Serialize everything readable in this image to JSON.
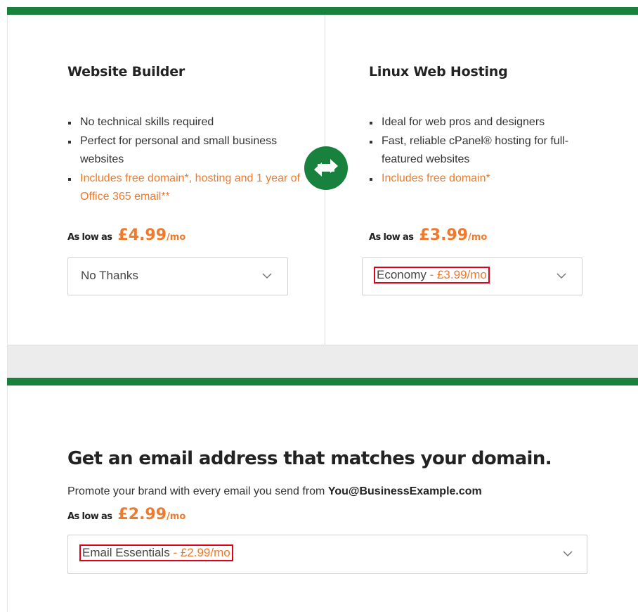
{
  "website_builder": {
    "title": "Website Builder",
    "features": [
      "No technical skills required",
      "Perfect for personal and small business websites",
      "Includes free domain*, hosting and 1 year of Office 365 email**"
    ],
    "as_low_as": "As low as",
    "price": "£4.99",
    "per": "/mo",
    "select_value": "No Thanks"
  },
  "linux_hosting": {
    "title": "Linux Web Hosting",
    "features": [
      "Ideal for web pros and designers",
      "Fast, reliable cPanel® hosting for full-featured websites",
      "Includes free domain*"
    ],
    "as_low_as": "As low as",
    "price": "£3.99",
    "per": "/mo",
    "select_plan": "Economy",
    "select_price": " - £3.99/mo"
  },
  "swap_icon": "swap-arrows-icon",
  "email": {
    "title": "Get an email address that matches your domain.",
    "desc_prefix": "Promote your brand with every email you send from ",
    "desc_address": "You@BusinessExample.com",
    "as_low_as": "As low as",
    "price": "£2.99",
    "per": "/mo",
    "select_plan": "Email Essentials",
    "select_price": " - £2.99/mo"
  },
  "colors": {
    "brand_green": "#17813d",
    "accent_orange": "#ef7a2b",
    "highlight_red": "#e0001a"
  }
}
